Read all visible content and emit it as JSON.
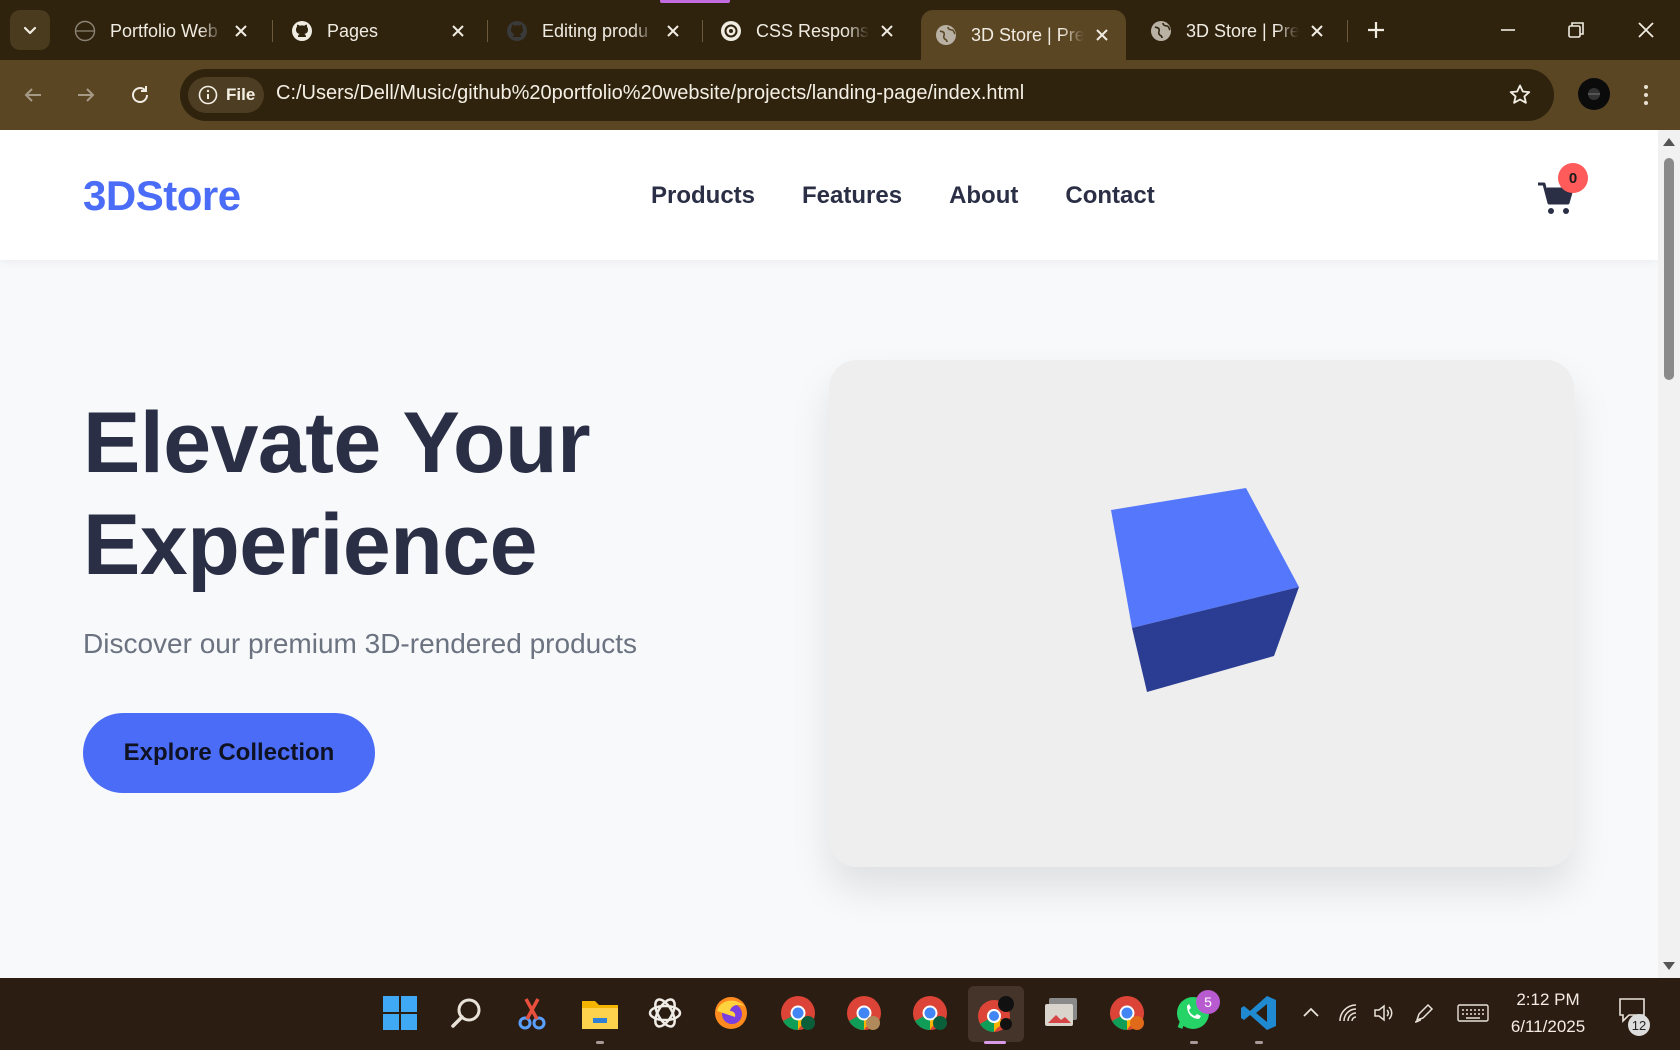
{
  "browser": {
    "tabs": [
      {
        "title": "Portfolio Web",
        "favicon": "globe-outline-icon",
        "active": false
      },
      {
        "title": "Pages",
        "favicon": "github-icon",
        "active": false
      },
      {
        "title": "Editing produ",
        "favicon": "github-icon",
        "active": false
      },
      {
        "title": "CSS Responsi",
        "favicon": "openai-icon",
        "active": false
      },
      {
        "title": "3D Store | Pre",
        "favicon": "globe-icon",
        "active": true
      },
      {
        "title": "3D Store | Pre",
        "favicon": "globe-icon",
        "active": false
      }
    ],
    "chip_label": "File",
    "url": "C:/Users/Dell/Music/github%20portfolio%20website/projects/landing-page/index.html"
  },
  "site": {
    "logo": "3DStore",
    "nav": [
      "Products",
      "Features",
      "About",
      "Contact"
    ],
    "cart_count": "0",
    "hero": {
      "title_line1": "Elevate Your",
      "title_line2": "Experience",
      "subtitle": "Discover our premium 3D-rendered products",
      "cta": "Explore Collection"
    }
  },
  "taskbar": {
    "apps": [
      "start-icon",
      "search-icon",
      "snipping-tool-icon",
      "file-explorer-icon",
      "chatgpt-icon",
      "firefox-icon",
      "chrome-icon",
      "chrome-icon",
      "chrome-icon",
      "chrome-icon",
      "photos-icon",
      "chrome-icon",
      "whatsapp-icon",
      "vscode-icon"
    ],
    "whatsapp_badge": "5",
    "time": "2:12 PM",
    "date": "6/11/2025",
    "notification_count": "12"
  },
  "colors": {
    "brand": "#4a6cf7",
    "tab_bar": "#2f230e",
    "toolbar": "#5b4624",
    "badge": "#ff5b5b",
    "taskbar": "#2c1d12"
  }
}
